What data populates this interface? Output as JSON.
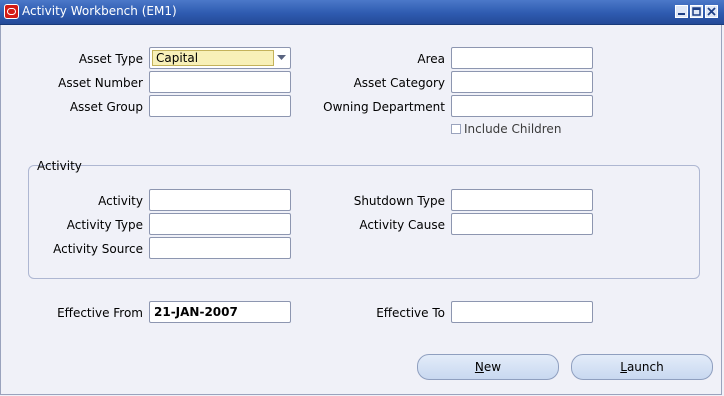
{
  "window": {
    "title": "Activity Workbench (EM1)",
    "controls": [
      "minimize-icon",
      "maximize-icon",
      "close-icon"
    ]
  },
  "asset": {
    "asset_type_label": "Asset Type",
    "asset_type_value": "Capital",
    "asset_number_label": "Asset Number",
    "asset_number_value": "",
    "asset_group_label": "Asset Group",
    "asset_group_value": "",
    "area_label": "Area",
    "area_value": "",
    "asset_category_label": "Asset Category",
    "asset_category_value": "",
    "owning_department_label": "Owning Department",
    "owning_department_value": "",
    "include_children_label": "Include Children",
    "include_children_checked": false
  },
  "activity": {
    "group_title": "Activity",
    "activity_label": "Activity",
    "activity_value": "",
    "activity_type_label": "Activity Type",
    "activity_type_value": "",
    "activity_source_label": "Activity Source",
    "activity_source_value": "",
    "shutdown_type_label": "Shutdown Type",
    "shutdown_type_value": "",
    "activity_cause_label": "Activity Cause",
    "activity_cause_value": ""
  },
  "dates": {
    "effective_from_label": "Effective From",
    "effective_from_value": "21-JAN-2007",
    "effective_to_label": "Effective To",
    "effective_to_value": ""
  },
  "buttons": {
    "new_label": "New",
    "launch_label": "Launch"
  },
  "colors": {
    "titlebar": "#2e5bb0",
    "background": "#f0f1f8",
    "select_highlight": "#f8f0b8",
    "button": "#d3e1f5"
  }
}
